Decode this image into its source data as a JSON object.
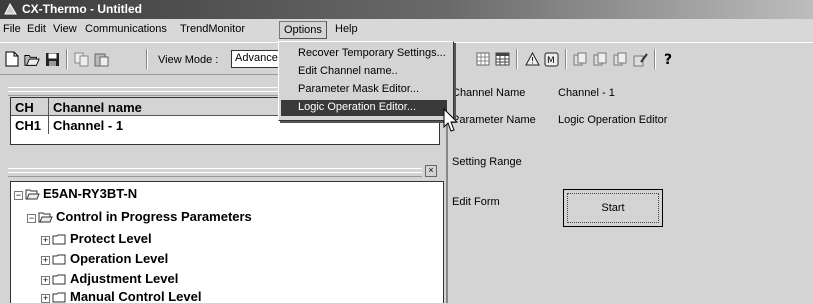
{
  "window": {
    "title": "CX-Thermo - Untitled"
  },
  "menubar": {
    "items": [
      "File",
      "Edit",
      "View",
      "Communications",
      "TrendMonitor",
      "Options",
      "Help"
    ],
    "open_menu": "Options"
  },
  "options_menu": {
    "items": [
      "Recover Temporary Settings...",
      "Edit Channel name..",
      "Parameter Mask Editor...",
      "Logic Operation Editor..."
    ],
    "highlighted_index": 3
  },
  "toolbar": {
    "view_mode_label": "View Mode :",
    "view_mode_value": "Advanced"
  },
  "channels": {
    "headers": [
      "CH",
      "Channel name"
    ],
    "rows": [
      {
        "ch": "CH1",
        "name": "Channel - 1"
      }
    ]
  },
  "tree": {
    "device": "E5AN-RY3BT-N",
    "group": "Control in Progress Parameters",
    "levels": [
      "Protect Level",
      "Operation Level",
      "Adjustment Level",
      "Manual Control Level"
    ]
  },
  "properties": {
    "channel_name_label": "Channel Name",
    "channel_name_value": "Channel - 1",
    "parameter_name_label": "Parameter Name",
    "parameter_name_value": "Logic Operation Editor",
    "setting_range_label": "Setting Range",
    "edit_form_label": "Edit Form",
    "start_button": "Start"
  },
  "icons": {
    "toolbar_left": [
      "new-icon",
      "open-icon",
      "save-icon",
      "copy-icon",
      "paste-icon"
    ],
    "toolbar_right": [
      "grid-icon",
      "table-icon",
      "warning-icon",
      "tag-icon",
      "doc1-icon",
      "doc2-icon",
      "doc3-icon",
      "doc-edit-icon",
      "help-icon"
    ]
  }
}
